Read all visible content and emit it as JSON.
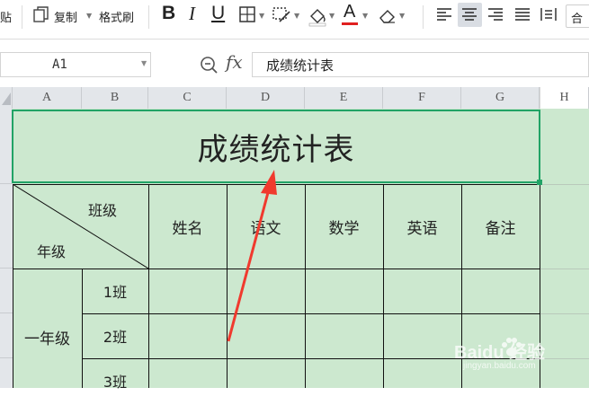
{
  "toolbar": {
    "paste_label": "贴",
    "copy_label": "复制",
    "format_painter_label": "格式刷",
    "bold": "B",
    "italic": "I",
    "underline": "U",
    "font_color_glyph": "A",
    "merge_label": "合"
  },
  "formula_bar": {
    "cell_ref": "A1",
    "fx": "fx",
    "content": "成绩统计表"
  },
  "columns": [
    "A",
    "B",
    "C",
    "D",
    "E",
    "F",
    "G",
    "H"
  ],
  "sheet": {
    "title": "成绩统计表",
    "diag_top": "班级",
    "diag_bottom": "年级",
    "headers": [
      "姓名",
      "语文",
      "数学",
      "英语",
      "备注"
    ],
    "grade": "一年级",
    "classes": [
      "1班",
      "2班",
      "3班"
    ]
  },
  "colors": {
    "cell_fill": "#cce8cf",
    "selection_border": "#21a366",
    "arrow": "#f03a2e",
    "header_bg": "#e3e6ea",
    "active_button_bg": "#d9dde3"
  },
  "watermark": {
    "brand": "Baidu 经验",
    "url": "jingyan.baidu.com"
  }
}
